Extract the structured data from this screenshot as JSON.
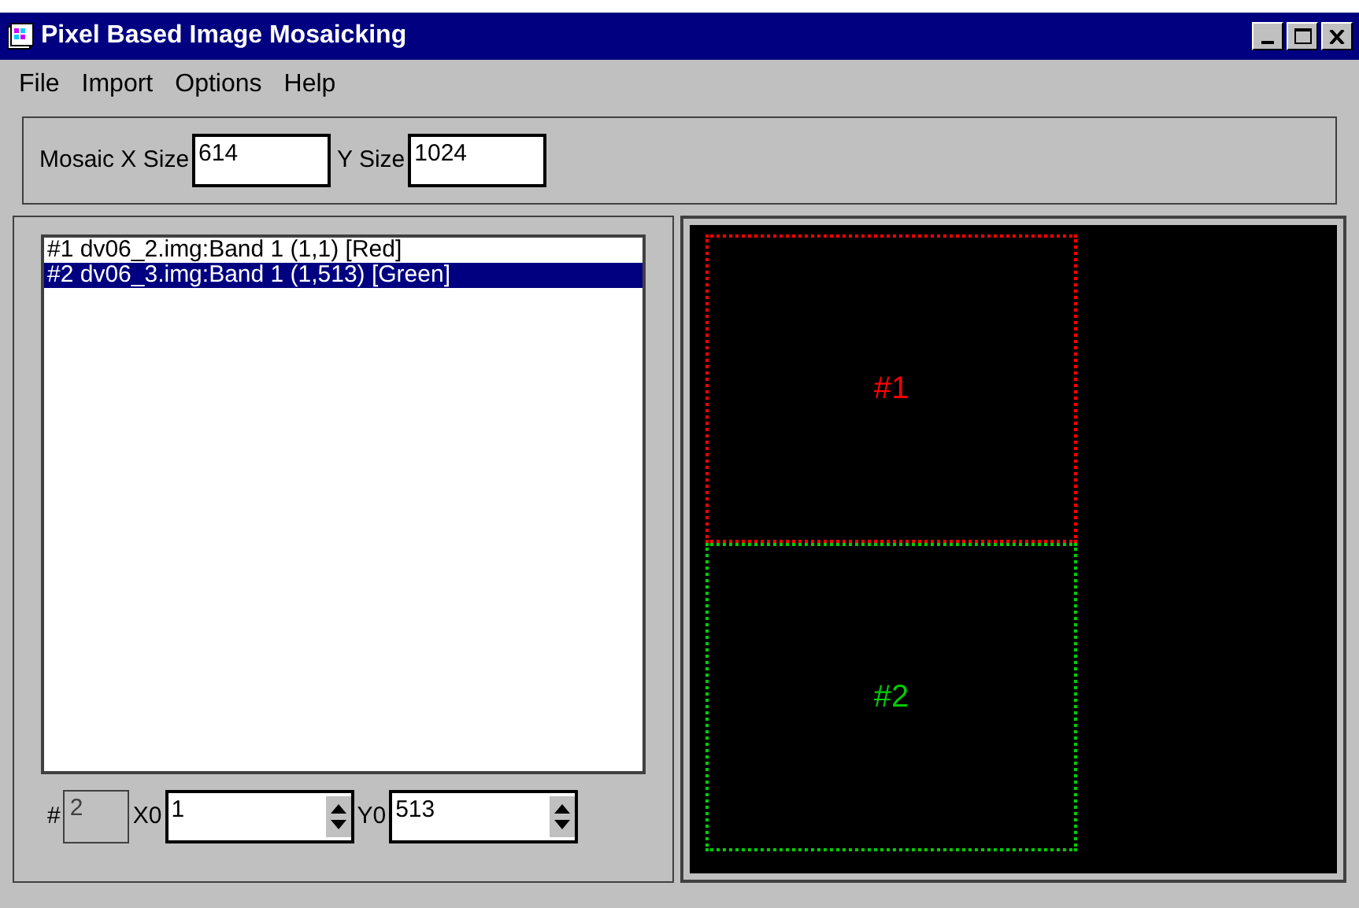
{
  "window": {
    "title": "Pixel Based Image Mosaicking"
  },
  "menu": [
    "File",
    "Import",
    "Options",
    "Help"
  ],
  "mosaic_size": {
    "x_label": "Mosaic X Size",
    "x_value": "614",
    "y_label": "Y Size",
    "y_value": "1024"
  },
  "image_list": [
    {
      "label": "#1 dv06_2.img:Band 1 (1,1) [Red]",
      "selected": false
    },
    {
      "label": "#2 dv06_3.img:Band 1 (1,513) [Green]",
      "selected": true
    }
  ],
  "position": {
    "index_label": "#",
    "index_value": "2",
    "x0_label": "X0",
    "x0_value": "1",
    "y0_label": "Y0",
    "y0_value": "513"
  },
  "canvas_tiles": [
    {
      "label": "#1",
      "color": "#ff0000"
    },
    {
      "label": "#2",
      "color": "#00cc00"
    }
  ]
}
